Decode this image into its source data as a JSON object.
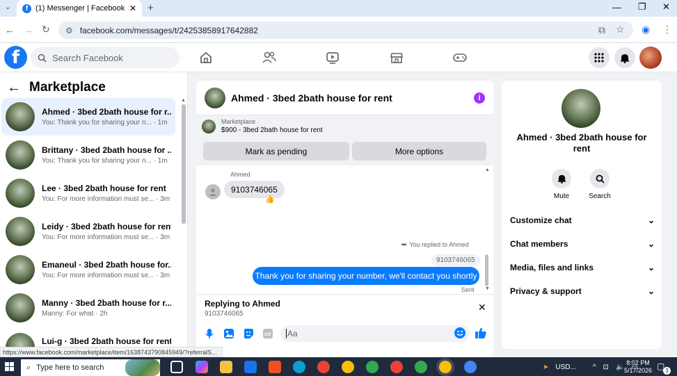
{
  "browser": {
    "tab_title": "(1) Messenger | Facebook",
    "url": "facebook.com/messages/t/24253858917642882",
    "status_url": "https://www.facebook.com/marketplace/item/1638743790845949/?referralS..."
  },
  "facebook": {
    "search_placeholder": "Search Facebook"
  },
  "left": {
    "title": "Marketplace",
    "conversations": [
      {
        "name": "Ahmed · 3bed 2bath house for r...",
        "preview": "You: Thank you for sharing your n...  · 1m"
      },
      {
        "name": "Brittany · 3bed 2bath house for ...",
        "preview": "You: Thank you for sharing your n...  · 1m"
      },
      {
        "name": "Lee · 3bed 2bath house for rent",
        "preview": "You: For more information must se... · 3m"
      },
      {
        "name": "Leidy · 3bed 2bath house for rent",
        "preview": "You: For more information must se... · 3m"
      },
      {
        "name": "Emaneul · 3bed 2bath house for...",
        "preview": "You: For more information must se... · 3m"
      },
      {
        "name": "Manny · 3bed 2bath house for r...",
        "preview": "Manny: For what · 2h"
      },
      {
        "name": "Lui-g · 3bed 2bath house for rent",
        "preview": ""
      }
    ]
  },
  "chat": {
    "title": "Ahmed · 3bed 2bath house for rent",
    "marketplace_label": "Marketplace",
    "listing": "$900 - 3bed 2bath house for rent",
    "mark_pending": "Mark as pending",
    "more_options": "More options",
    "sender": "Ahmed",
    "incoming": "9103746065",
    "reaction": "👍",
    "replied_note": "You replied to Ahmed",
    "quoted": "9103746065",
    "outgoing": "Thank you for sharing your number, we'll contact you shortly",
    "status": "Sent",
    "replying_to": "Replying to Ahmed",
    "replying_snippet": "9103746065",
    "input_placeholder": "Aa"
  },
  "right": {
    "title": "Ahmed · 3bed 2bath house for rent",
    "mute": "Mute",
    "search": "Search",
    "sections": [
      "Customize chat",
      "Chat members",
      "Media, files and links",
      "Privacy & support"
    ]
  },
  "taskbar": {
    "search_placeholder": "Type here to search",
    "currency": "USD...",
    "time": "8:02 PM",
    "date": "5/17/2026",
    "notifications": "3"
  },
  "colors": {
    "brand": "#1877f2",
    "outgoing_bubble": "#0a7cff",
    "info": "#a033ff"
  }
}
